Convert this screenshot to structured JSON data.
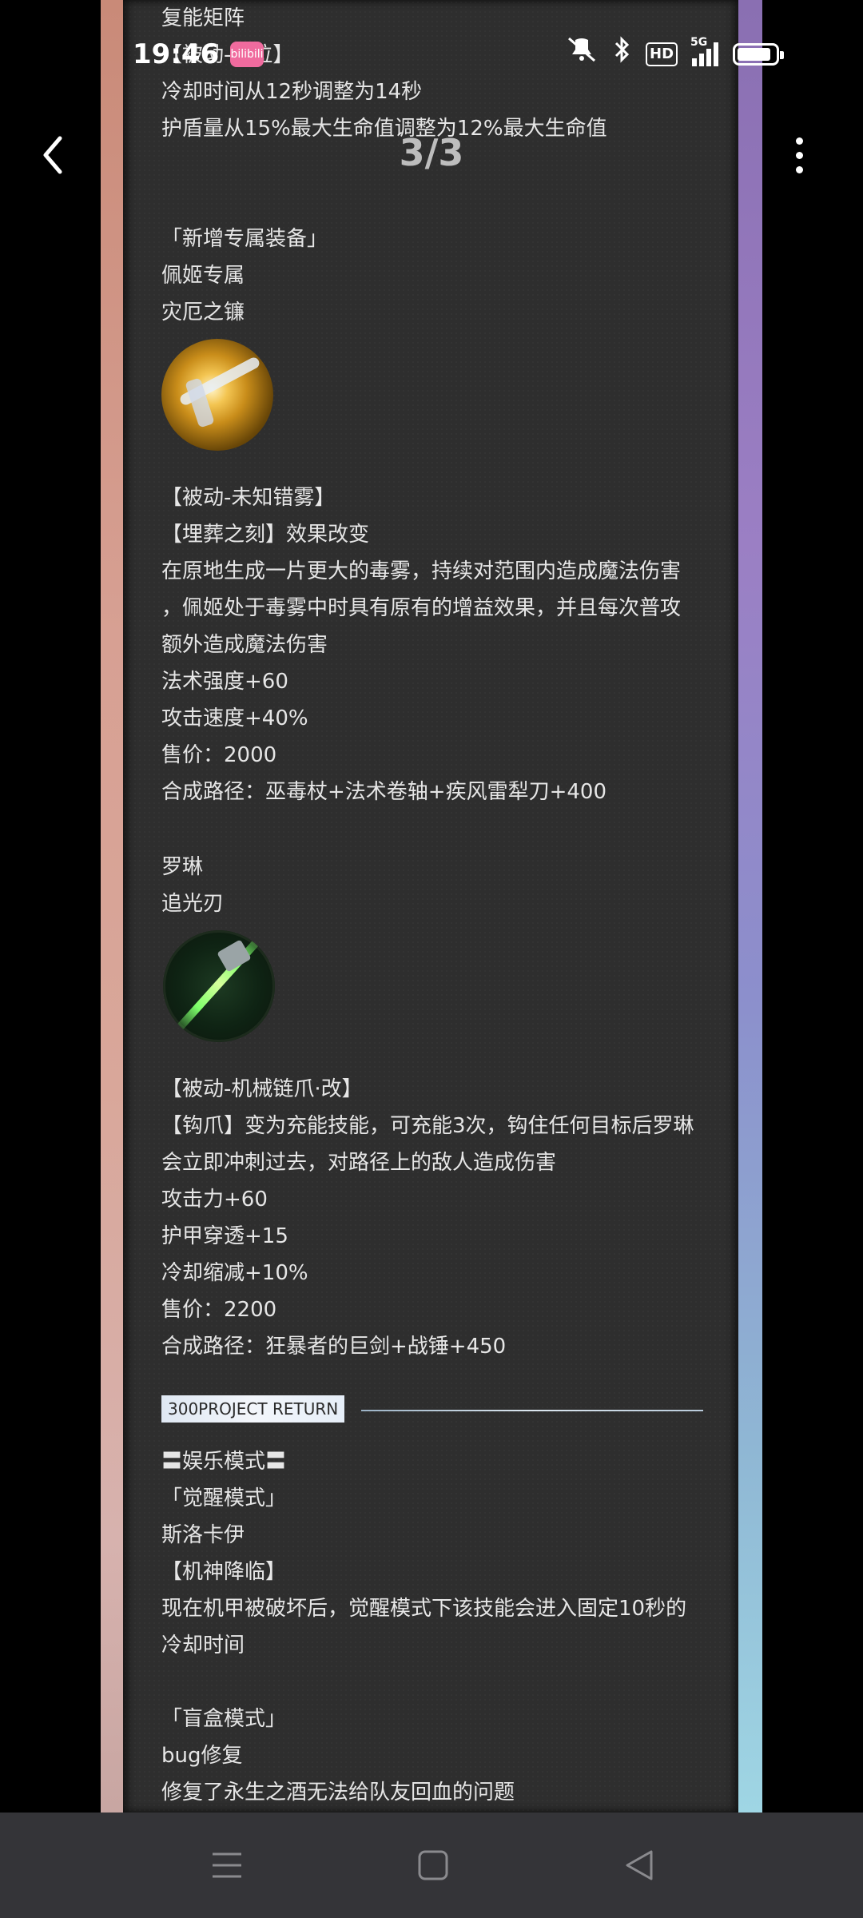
{
  "status_bar": {
    "time": "19:46",
    "app_badge": "bilibili",
    "icons": [
      "mute-icon",
      "bluetooth-icon",
      "hd-icon",
      "5g-signal-icon",
      "battery-icon"
    ],
    "hd_label": "HD",
    "network_label": "5G",
    "battery_level": 0.9
  },
  "viewer": {
    "page_counter": "3/3",
    "back_icon": "chevron-left-icon",
    "more_icon": "more-vertical-icon"
  },
  "document": {
    "lines": [
      "复能矩阵",
      "【被动-复位】",
      "冷却时间从12秒调整为14秒",
      "护盾量从15%最大生命值调整为12%最大生命值",
      "「新增专属装备」",
      "佩姬专属",
      "灾厄之镰",
      "【被动-未知错雾】",
      "【埋葬之刻】效果改变",
      "在原地生成一片更大的毒雾，持续对范围内造成魔法伤害",
      "，佩姬处于毒雾中时具有原有的增益效果，并且每次普攻",
      "额外造成魔法伤害",
      "法术强度+60",
      "攻击速度+40%",
      "售价：2000",
      "合成路径：巫毒杖+法术卷轴+疾风雷犁刀+400",
      "罗琳",
      "追光刃",
      "【被动-机械链爪·改】",
      "【钩爪】变为充能技能，可充能3次，钩住任何目标后罗琳",
      "会立即冲刺过去，对路径上的敌人造成伤害",
      "攻击力+60",
      "护甲穿透+15",
      "冷却缩减+10%",
      "售价：2200",
      "合成路径：狂暴者的巨剑+战锤+450",
      "〓娱乐模式〓",
      "「觉醒模式」",
      "斯洛卡伊",
      "【机神降临】",
      "现在机甲被破坏后，觉醒模式下该技能会进入固定10秒的",
      "冷却时间",
      "「盲盒模式」",
      "bug修复",
      "修复了永生之酒无法给队友回血的问题"
    ],
    "section_tag": "300PROJECT RETURN",
    "item_images": [
      "scythe-item-icon",
      "light-blade-item-icon"
    ]
  },
  "nav_bar": {
    "icons": [
      "menu-icon",
      "home-square-icon",
      "back-triangle-icon"
    ]
  }
}
